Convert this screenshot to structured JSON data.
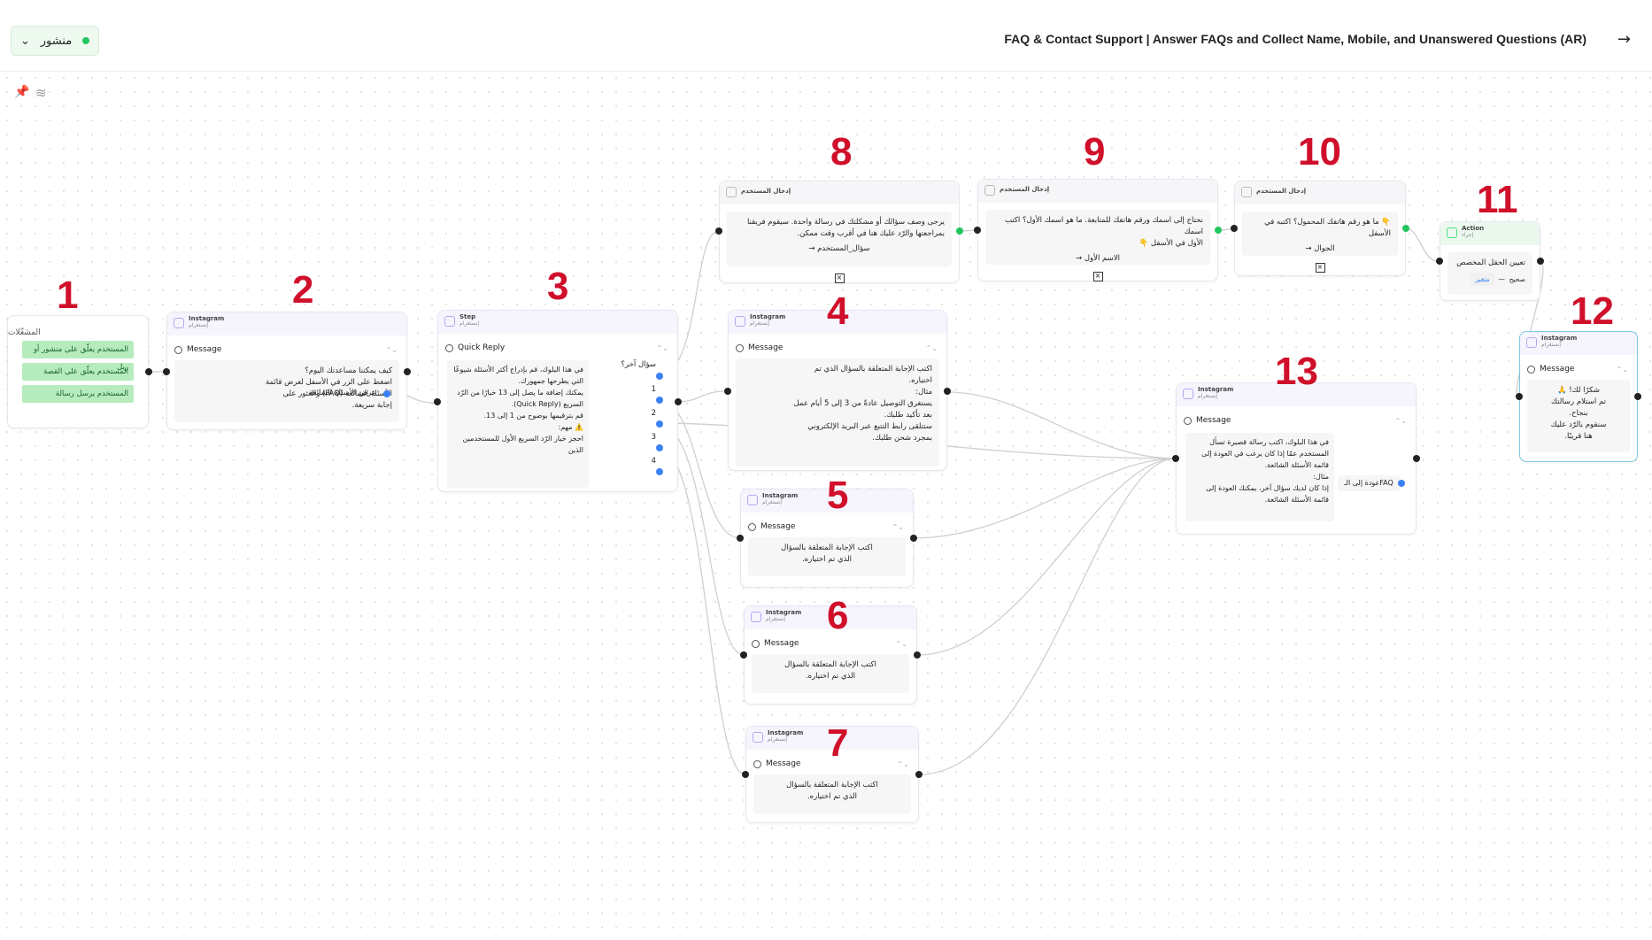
{
  "header": {
    "status": "منشور",
    "title": "FAQ & Contact Support | Answer FAQs and Collect Name, Mobile, and Unanswered Questions (AR)",
    "back_icon": "arrow-right-icon"
  },
  "toolbar": {
    "pin_icon": "pin-icon",
    "layers_icon": "layers-icon"
  },
  "labels": [
    "1",
    "2",
    "3",
    "4",
    "5",
    "6",
    "7",
    "8",
    "9",
    "10",
    "11",
    "12",
    "13"
  ],
  "trigger": {
    "heading": "المشغّلات",
    "items": [
      "المستخدم يعلّق على منشور أو ريل",
      "المستخدم يعلّق على القصة",
      "المستخدم يرسل رسالة"
    ]
  },
  "n2": {
    "channel": "Instagram",
    "sub": "إنستغرام",
    "type": "Message",
    "lines": [
      "كيف يمكننا مساعدتك اليوم؟",
      "اضغط على الزر في الأسفل لعرض قائمة",
      "الأسئلة الشائعة (FAQ) والعثور على",
      "إجابة سريعة."
    ],
    "button": "عرض الأسئلة الشائعة"
  },
  "n3": {
    "channel": "Step",
    "sub": "إنستغرام",
    "type": "Quick Reply",
    "lines": [
      "في هذا البلوك، قم بإدراج أكثر الأسئلة شيوعًا",
      "التي يطرحها جمهورك.",
      "يمكنك إضافة ما يصل إلى 13 خيارًا من الرّد",
      "السريع (Quick Reply).",
      "قم بترقيمها بوضوح من 1 إلى 13.",
      "",
      "⚠️ مهم:",
      "احجز خيار الرّد السريع الأول للمستخدمين الذين"
    ],
    "options": [
      "سؤال آخر؟",
      "1",
      "2",
      "3",
      "4"
    ]
  },
  "n4": {
    "channel": "Instagram",
    "sub": "إنستغرام",
    "type": "Message",
    "lines": [
      "اكتب الإجابة المتعلقة بالسؤال الذي تم",
      "اختياره.",
      "",
      "مثال:",
      "يستغرق التوصيل عادةً من 3 إلى 5 أيام عمل",
      "بعد تأكيد طلبك.",
      "ستتلقى رابط التتبع عبر البريد الإلكتروني",
      "بمجرد شحن طلبك."
    ]
  },
  "n5": {
    "channel": "Instagram",
    "sub": "إنستغرام",
    "type": "Message",
    "lines": [
      "اكتب الإجابة المتعلقة بالسؤال",
      "الذي تم اختياره."
    ]
  },
  "n6": {
    "channel": "Instagram",
    "sub": "إنستغرام",
    "type": "Message",
    "lines": [
      "اكتب الإجابة المتعلقة بالسؤال",
      "الذي تم اختياره."
    ]
  },
  "n7": {
    "channel": "Instagram",
    "sub": "إنستغرام",
    "type": "Message",
    "lines": [
      "اكتب الإجابة المتعلقة بالسؤال",
      "الذي تم اختياره."
    ]
  },
  "n8": {
    "channel": "إدخال المستخدم",
    "lines": [
      "يرجى وصف سؤالك أو مشكلتك في رسالة واحدة. سيقوم فريقنا",
      "بمراجعتها والرّد عليك هنا في أقرب وقت ممكن."
    ],
    "answer": "سؤال_المستخدم"
  },
  "n9": {
    "channel": "إدخال المستخدم",
    "lines": [
      "نحتاج إلى اسمك ورقم هاتفك للمتابعة. ما هو اسمك الأول؟ اكتب اسمك",
      "الأول في الأسفل 👇"
    ],
    "answer": "الاسم الأول"
  },
  "n10": {
    "channel": "إدخال المستخدم",
    "lines": [
      "👇 ما هو رقم هاتفك المحمول؟ اكتبه في الأسفل"
    ],
    "answer": "الجوال"
  },
  "n11": {
    "channel": "Action",
    "sub": "إجراء",
    "title": "تعيين الحقل المخصص",
    "field": "متغير",
    "value": "صحيح"
  },
  "n12": {
    "channel": "Instagram",
    "sub": "إنستغرام",
    "type": "Message",
    "lines": [
      "شكرًا لك! 🙏",
      "تم استلام رسالتك",
      "بنجاح.",
      "سنقوم بالرّد عليك",
      "هنا قريبًا."
    ]
  },
  "n13": {
    "channel": "Instagram",
    "sub": "إنستغرام",
    "type": "Message",
    "lines": [
      "في هذا البلوك، اكتب رسالة قصيرة تسأل",
      "المستخدم عمّا إذا كان يرغب في العودة إلى",
      "قائمة الأسئلة الشائعة.",
      "",
      "مثال:",
      "إذا كان لديك سؤال آخر، يمكنك العودة إلى",
      "قائمة الأسئلة الشائعة."
    ],
    "button": "FAQعودة إلى الـ"
  }
}
